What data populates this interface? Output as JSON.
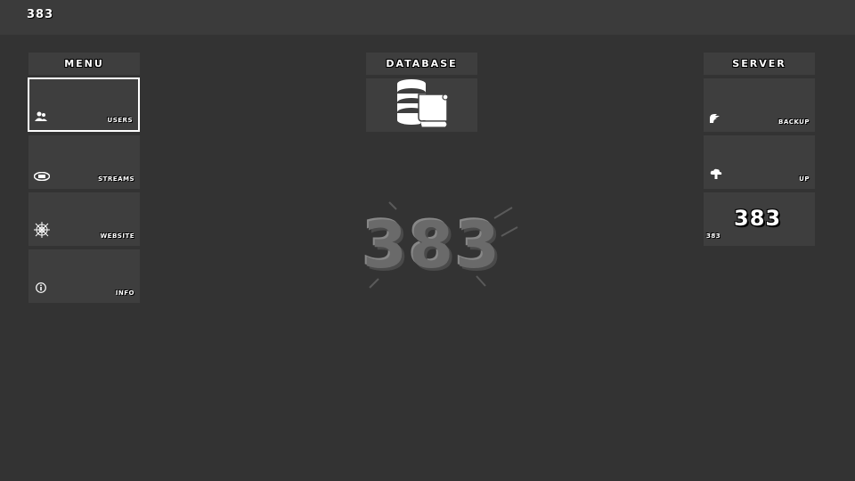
{
  "app": {
    "logo_text": "383"
  },
  "columns": {
    "menu": {
      "header": "MENU",
      "items": [
        {
          "label": "USERS",
          "icon": "users-icon",
          "focused": true
        },
        {
          "label": "STREAMS",
          "icon": "stream-icon",
          "focused": false
        },
        {
          "label": "WEBSITE",
          "icon": "web-icon",
          "focused": false
        },
        {
          "label": "INFO",
          "icon": "info-icon",
          "focused": false
        }
      ]
    },
    "database": {
      "header": "DATABASE"
    },
    "server": {
      "header": "SERVER",
      "items": [
        {
          "label": "BACKUP",
          "icon": "backup-icon"
        },
        {
          "label": "UP",
          "icon": "upload-cloud-icon"
        },
        {
          "label": "383",
          "sublabel": "383",
          "icon": "logo-icon"
        }
      ]
    }
  },
  "center": {
    "logo_text": "383"
  },
  "colors": {
    "background": "#333333",
    "topbar": "#3b3b3b",
    "tile": "#3e3e3e",
    "focus_border": "#ffffff"
  }
}
